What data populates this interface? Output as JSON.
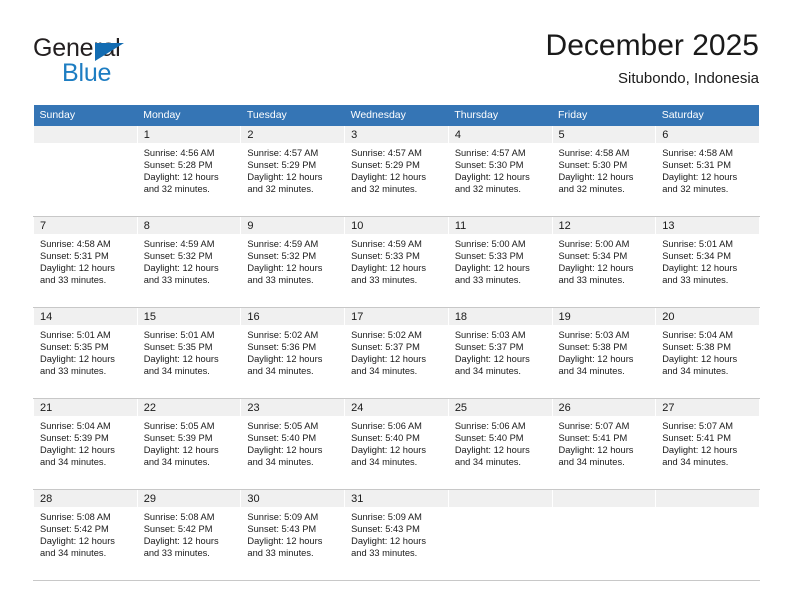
{
  "brand": {
    "name_top": "General",
    "name_bottom": "Blue",
    "triangle_color": "#136cb2",
    "blue_color": "#1d7dc2"
  },
  "header": {
    "month_title": "December 2025",
    "location": "Situbondo, Indonesia"
  },
  "theme": {
    "header_bg": "#3575b5",
    "header_text": "#ffffff",
    "daynum_bg": "#f0f0f0",
    "cell_border": "#c8c8c8"
  },
  "calendar": {
    "weekday_headers": [
      "Sunday",
      "Monday",
      "Tuesday",
      "Wednesday",
      "Thursday",
      "Friday",
      "Saturday"
    ],
    "weeks": [
      [
        {
          "date": "",
          "lines": []
        },
        {
          "date": "1",
          "lines": [
            "Sunrise: 4:56 AM",
            "Sunset: 5:28 PM",
            "Daylight: 12 hours",
            "and 32 minutes."
          ]
        },
        {
          "date": "2",
          "lines": [
            "Sunrise: 4:57 AM",
            "Sunset: 5:29 PM",
            "Daylight: 12 hours",
            "and 32 minutes."
          ]
        },
        {
          "date": "3",
          "lines": [
            "Sunrise: 4:57 AM",
            "Sunset: 5:29 PM",
            "Daylight: 12 hours",
            "and 32 minutes."
          ]
        },
        {
          "date": "4",
          "lines": [
            "Sunrise: 4:57 AM",
            "Sunset: 5:30 PM",
            "Daylight: 12 hours",
            "and 32 minutes."
          ]
        },
        {
          "date": "5",
          "lines": [
            "Sunrise: 4:58 AM",
            "Sunset: 5:30 PM",
            "Daylight: 12 hours",
            "and 32 minutes."
          ]
        },
        {
          "date": "6",
          "lines": [
            "Sunrise: 4:58 AM",
            "Sunset: 5:31 PM",
            "Daylight: 12 hours",
            "and 32 minutes."
          ]
        }
      ],
      [
        {
          "date": "7",
          "lines": [
            "Sunrise: 4:58 AM",
            "Sunset: 5:31 PM",
            "Daylight: 12 hours",
            "and 33 minutes."
          ]
        },
        {
          "date": "8",
          "lines": [
            "Sunrise: 4:59 AM",
            "Sunset: 5:32 PM",
            "Daylight: 12 hours",
            "and 33 minutes."
          ]
        },
        {
          "date": "9",
          "lines": [
            "Sunrise: 4:59 AM",
            "Sunset: 5:32 PM",
            "Daylight: 12 hours",
            "and 33 minutes."
          ]
        },
        {
          "date": "10",
          "lines": [
            "Sunrise: 4:59 AM",
            "Sunset: 5:33 PM",
            "Daylight: 12 hours",
            "and 33 minutes."
          ]
        },
        {
          "date": "11",
          "lines": [
            "Sunrise: 5:00 AM",
            "Sunset: 5:33 PM",
            "Daylight: 12 hours",
            "and 33 minutes."
          ]
        },
        {
          "date": "12",
          "lines": [
            "Sunrise: 5:00 AM",
            "Sunset: 5:34 PM",
            "Daylight: 12 hours",
            "and 33 minutes."
          ]
        },
        {
          "date": "13",
          "lines": [
            "Sunrise: 5:01 AM",
            "Sunset: 5:34 PM",
            "Daylight: 12 hours",
            "and 33 minutes."
          ]
        }
      ],
      [
        {
          "date": "14",
          "lines": [
            "Sunrise: 5:01 AM",
            "Sunset: 5:35 PM",
            "Daylight: 12 hours",
            "and 33 minutes."
          ]
        },
        {
          "date": "15",
          "lines": [
            "Sunrise: 5:01 AM",
            "Sunset: 5:35 PM",
            "Daylight: 12 hours",
            "and 34 minutes."
          ]
        },
        {
          "date": "16",
          "lines": [
            "Sunrise: 5:02 AM",
            "Sunset: 5:36 PM",
            "Daylight: 12 hours",
            "and 34 minutes."
          ]
        },
        {
          "date": "17",
          "lines": [
            "Sunrise: 5:02 AM",
            "Sunset: 5:37 PM",
            "Daylight: 12 hours",
            "and 34 minutes."
          ]
        },
        {
          "date": "18",
          "lines": [
            "Sunrise: 5:03 AM",
            "Sunset: 5:37 PM",
            "Daylight: 12 hours",
            "and 34 minutes."
          ]
        },
        {
          "date": "19",
          "lines": [
            "Sunrise: 5:03 AM",
            "Sunset: 5:38 PM",
            "Daylight: 12 hours",
            "and 34 minutes."
          ]
        },
        {
          "date": "20",
          "lines": [
            "Sunrise: 5:04 AM",
            "Sunset: 5:38 PM",
            "Daylight: 12 hours",
            "and 34 minutes."
          ]
        }
      ],
      [
        {
          "date": "21",
          "lines": [
            "Sunrise: 5:04 AM",
            "Sunset: 5:39 PM",
            "Daylight: 12 hours",
            "and 34 minutes."
          ]
        },
        {
          "date": "22",
          "lines": [
            "Sunrise: 5:05 AM",
            "Sunset: 5:39 PM",
            "Daylight: 12 hours",
            "and 34 minutes."
          ]
        },
        {
          "date": "23",
          "lines": [
            "Sunrise: 5:05 AM",
            "Sunset: 5:40 PM",
            "Daylight: 12 hours",
            "and 34 minutes."
          ]
        },
        {
          "date": "24",
          "lines": [
            "Sunrise: 5:06 AM",
            "Sunset: 5:40 PM",
            "Daylight: 12 hours",
            "and 34 minutes."
          ]
        },
        {
          "date": "25",
          "lines": [
            "Sunrise: 5:06 AM",
            "Sunset: 5:40 PM",
            "Daylight: 12 hours",
            "and 34 minutes."
          ]
        },
        {
          "date": "26",
          "lines": [
            "Sunrise: 5:07 AM",
            "Sunset: 5:41 PM",
            "Daylight: 12 hours",
            "and 34 minutes."
          ]
        },
        {
          "date": "27",
          "lines": [
            "Sunrise: 5:07 AM",
            "Sunset: 5:41 PM",
            "Daylight: 12 hours",
            "and 34 minutes."
          ]
        }
      ],
      [
        {
          "date": "28",
          "lines": [
            "Sunrise: 5:08 AM",
            "Sunset: 5:42 PM",
            "Daylight: 12 hours",
            "and 34 minutes."
          ]
        },
        {
          "date": "29",
          "lines": [
            "Sunrise: 5:08 AM",
            "Sunset: 5:42 PM",
            "Daylight: 12 hours",
            "and 33 minutes."
          ]
        },
        {
          "date": "30",
          "lines": [
            "Sunrise: 5:09 AM",
            "Sunset: 5:43 PM",
            "Daylight: 12 hours",
            "and 33 minutes."
          ]
        },
        {
          "date": "31",
          "lines": [
            "Sunrise: 5:09 AM",
            "Sunset: 5:43 PM",
            "Daylight: 12 hours",
            "and 33 minutes."
          ]
        },
        {
          "date": "",
          "lines": []
        },
        {
          "date": "",
          "lines": []
        },
        {
          "date": "",
          "lines": []
        }
      ]
    ]
  }
}
